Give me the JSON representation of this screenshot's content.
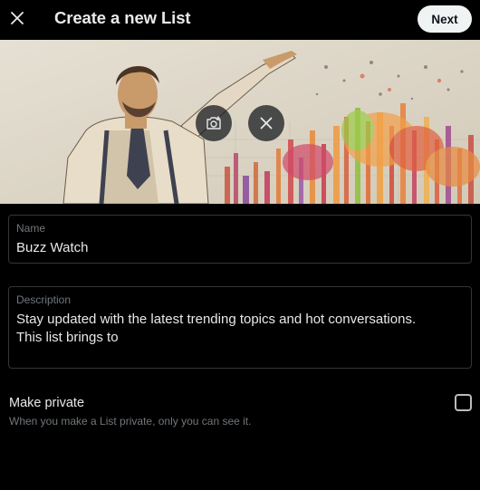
{
  "header": {
    "close_icon": "close-icon",
    "title": "Create a new List",
    "next_label": "Next"
  },
  "banner": {
    "image_description_icon": "banner-image",
    "add_photo_icon": "add-photo-icon",
    "remove_photo_icon": "remove-photo-icon"
  },
  "form": {
    "name_label": "Name",
    "name_value": "Buzz Watch",
    "description_label": "Description",
    "description_line1": "Stay updated with the latest trending topics and hot conversations.",
    "description_line2": "This list brings to"
  },
  "private": {
    "title": "Make private",
    "subtitle": "When you make a List private, only you can see it.",
    "checked": false
  },
  "colors": {
    "background": "#000000",
    "text": "#e7e9ea",
    "muted": "#71767b",
    "border": "#333639",
    "next_bg": "#eff3f4"
  }
}
